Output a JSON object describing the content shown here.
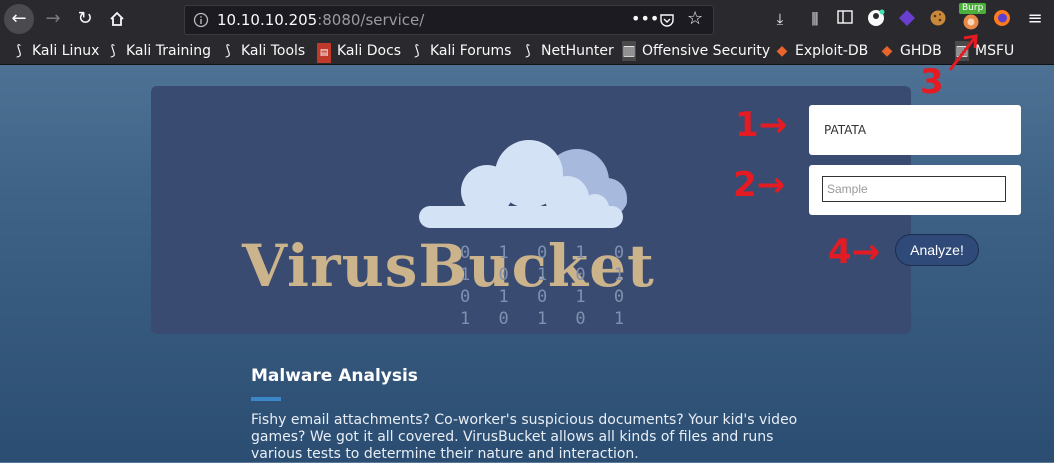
{
  "browser": {
    "url_host": "10.10.10.205",
    "url_rest": ":8080/service/",
    "burp_badge": "Burp",
    "bookmarks": [
      {
        "label": "Kali Linux",
        "icon": "kali-dragon-icon"
      },
      {
        "label": "Kali Training",
        "icon": "kali-dragon-icon"
      },
      {
        "label": "Kali Tools",
        "icon": "kali-dragon-icon"
      },
      {
        "label": "Kali Docs",
        "icon": "docs-icon"
      },
      {
        "label": "Kali Forums",
        "icon": "kali-dragon-icon"
      },
      {
        "label": "NetHunter",
        "icon": "nethunter-icon"
      },
      {
        "label": "Offensive Security",
        "icon": "offsec-icon"
      },
      {
        "label": "Exploit-DB",
        "icon": "exploit-db-icon"
      },
      {
        "label": "GHDB",
        "icon": "ghdb-icon"
      },
      {
        "label": "MSFU",
        "icon": "msfu-icon"
      }
    ]
  },
  "hero": {
    "brand": "VirusBucket",
    "binary_lines": [
      "0 1 0 1 0",
      "1 0 1 0 1",
      "0 1 0 1 0",
      "1 0 1 0 1"
    ]
  },
  "form": {
    "name_value": "PATATA",
    "sample_placeholder": "Sample",
    "analyze_label": "Analyze!"
  },
  "annotations": {
    "a1": "1→",
    "a2": "2→",
    "a3": "3",
    "a4": "4→"
  },
  "section": {
    "title": "Malware Analysis",
    "description": "Fishy email attachments? Co-worker's suspicious documents? Your kid's video games? We got it all covered. VirusBucket allows all kinds of files and runs various tests to determine their nature and interaction."
  },
  "colors": {
    "brand_gold": "#cbb38b",
    "annotation_red": "#e41b23",
    "hero_bg": "#394b70"
  }
}
